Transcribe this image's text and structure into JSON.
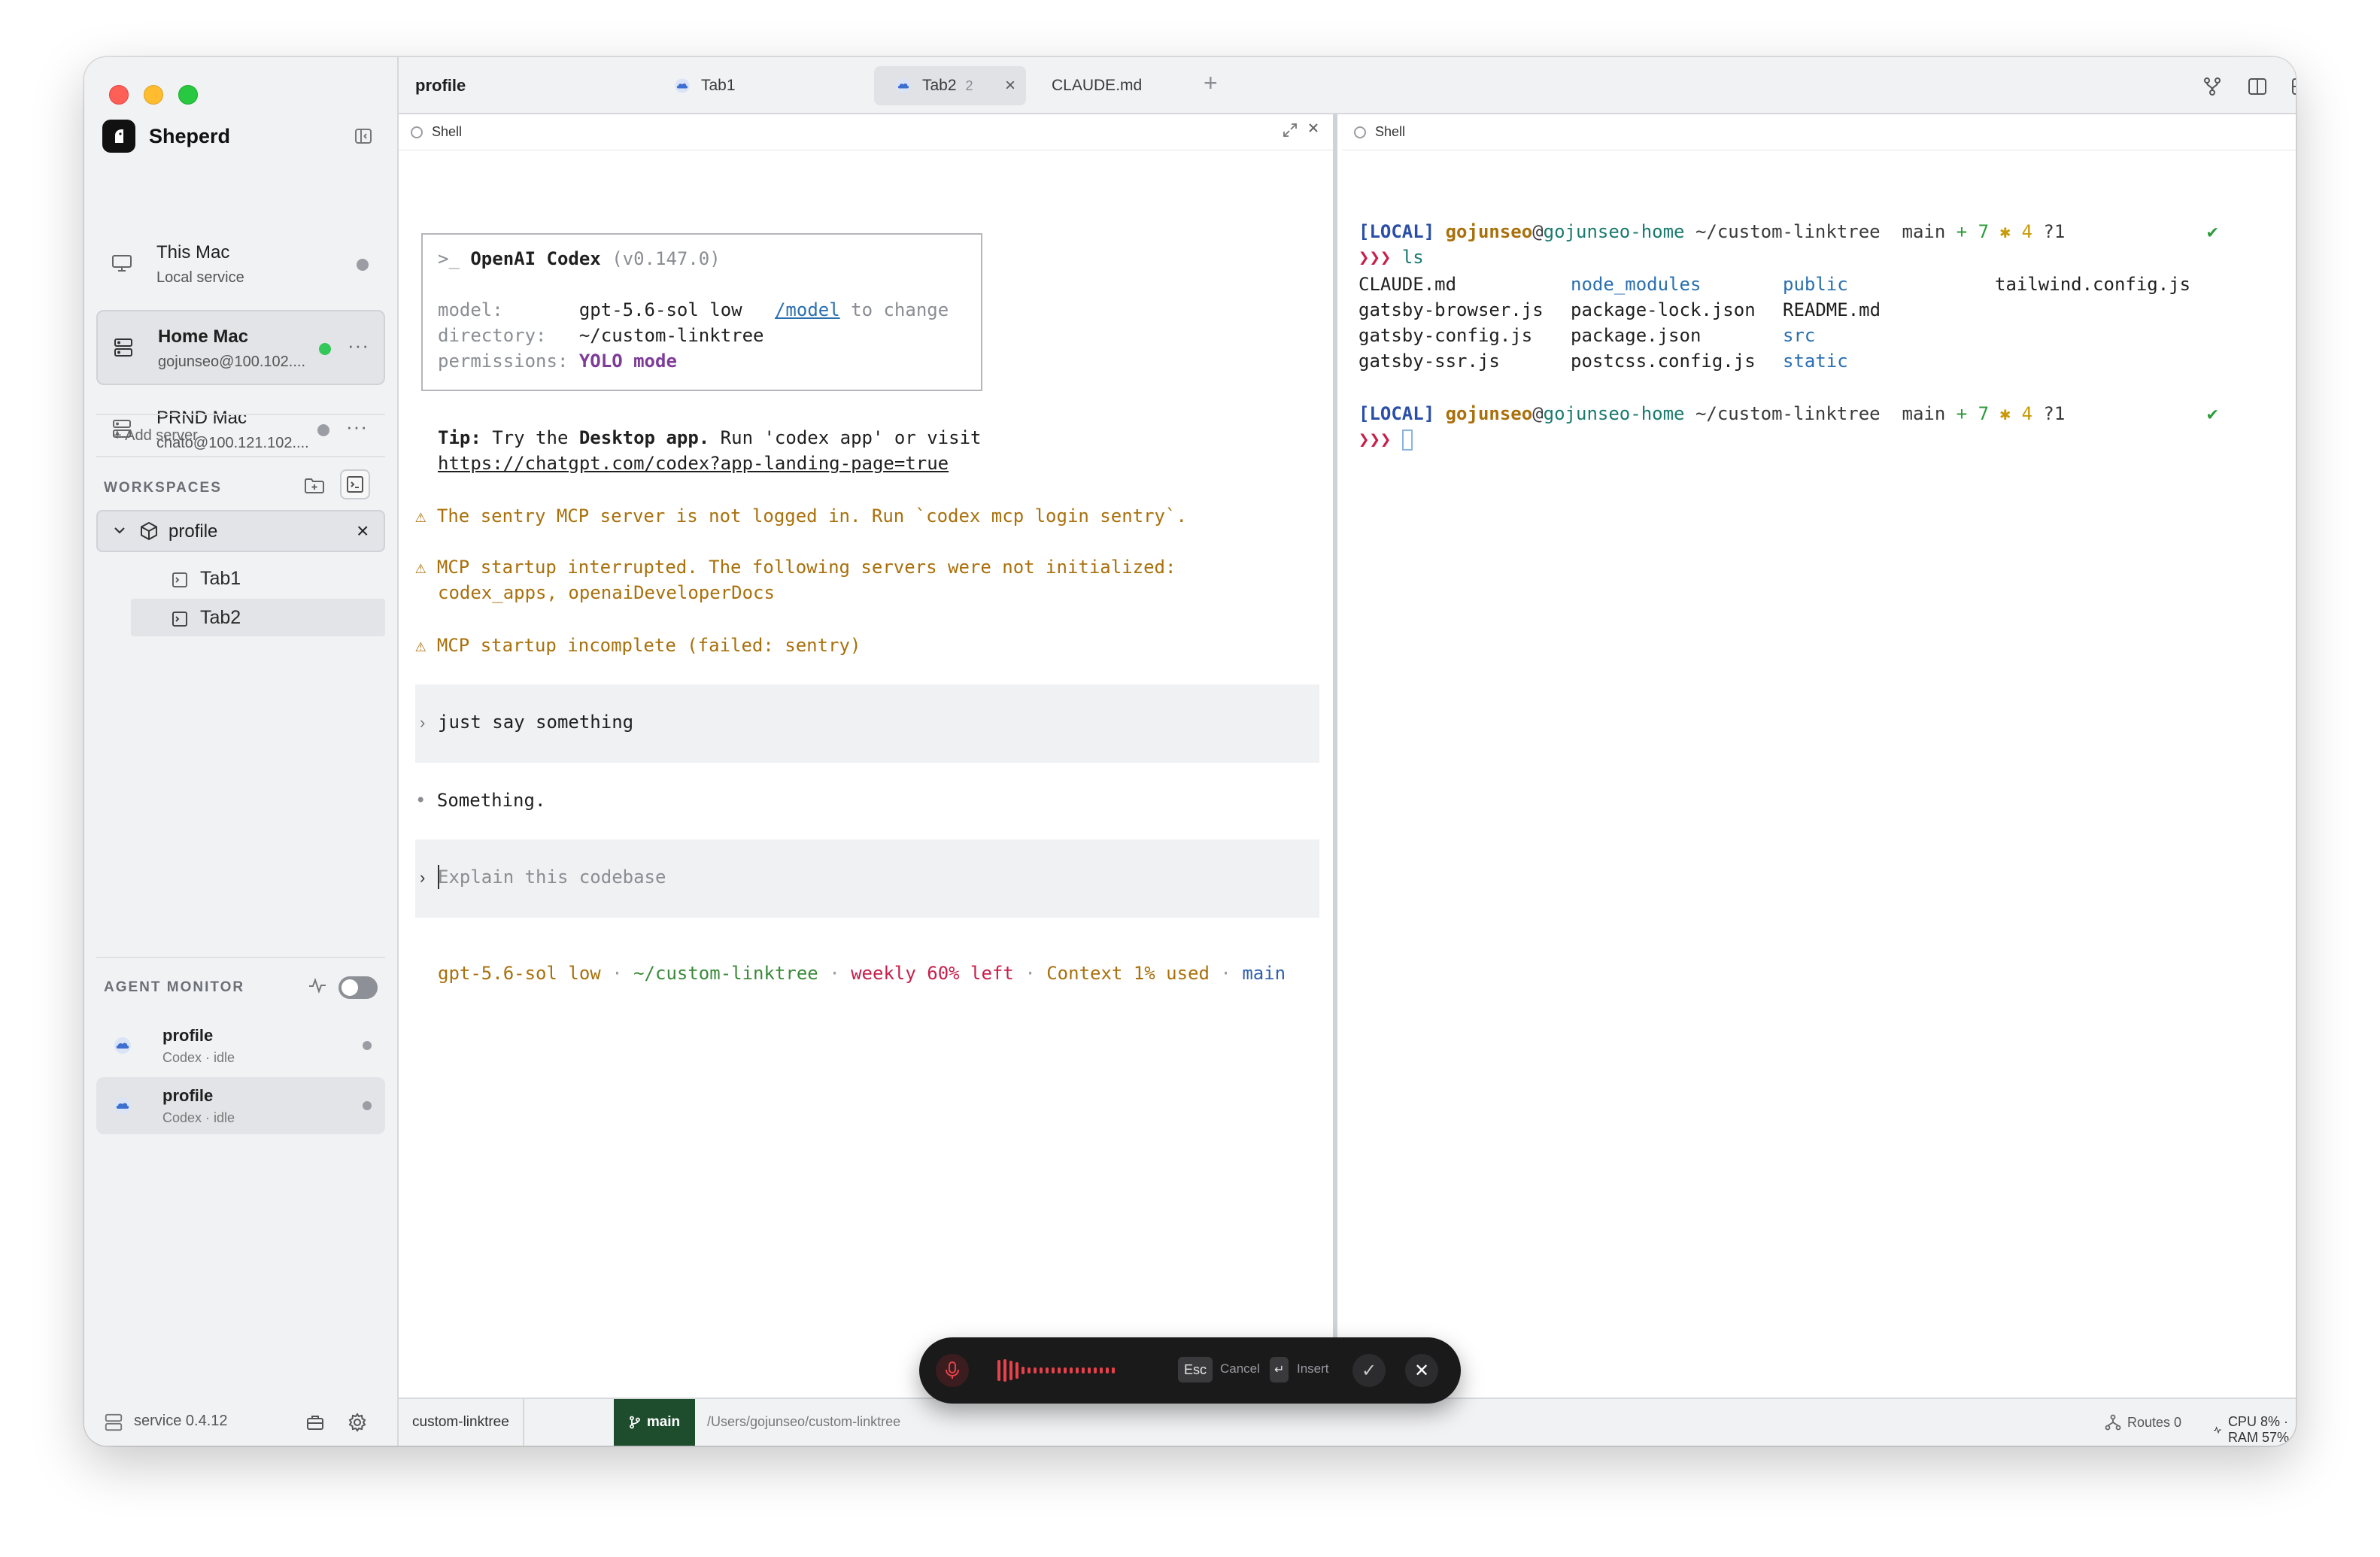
{
  "app": {
    "name": "Sheperd"
  },
  "servers": [
    {
      "name": "This Mac",
      "sub": "Local service",
      "status": "idle"
    },
    {
      "name": "Home Mac",
      "sub": "gojunseo@100.102....",
      "status": "online",
      "more": "···"
    },
    {
      "name": "PRND Mac",
      "sub": "chato@100.121.102....",
      "status": "offline",
      "more": "···"
    }
  ],
  "add_server_label": "+ Add server",
  "workspaces": {
    "label": "WORKSPACES",
    "active": {
      "name": "profile",
      "close": "×"
    },
    "tabs": [
      {
        "label": "Tab1"
      },
      {
        "label": "Tab2"
      }
    ]
  },
  "agent_monitor": {
    "label": "AGENT MONITOR",
    "enabled": false,
    "agents": [
      {
        "name": "profile",
        "status": "Codex · idle"
      },
      {
        "name": "profile",
        "status": "Codex · idle"
      }
    ]
  },
  "sidebar_footer": {
    "service": "service 0.4.12"
  },
  "topbar": {
    "workspace_title": "profile",
    "tabs": [
      {
        "label": "Tab1"
      },
      {
        "label": "Tab2",
        "count": "2",
        "close": "×"
      },
      {
        "label": "CLAUDE.md"
      }
    ],
    "add": "+"
  },
  "left_pane": {
    "title": "Shell",
    "codex_box": {
      "header_prompt": ">_",
      "header_name": "OpenAI Codex",
      "header_version": "(v0.147.0)",
      "model_key": "model:",
      "model_value": "gpt-5.6-sol low",
      "model_link": "/model",
      "model_hint": "to change",
      "dir_key": "directory:",
      "dir_value": "~/custom-linktree",
      "perm_key": "permissions:",
      "perm_value": "YOLO mode"
    },
    "tip": {
      "label": "Tip:",
      "text1": " Try the ",
      "bold": "Desktop app.",
      "text2": " Run 'codex app' or visit",
      "url": "https://chatgpt.com/codex?app-landing-page=true"
    },
    "warnings": [
      "⚠ The sentry MCP server is not logged in. Run `codex mcp login sentry`.",
      "⚠ MCP startup interrupted. The following servers were not initialized:",
      "codex_apps, openaiDeveloperDocs",
      "⚠ MCP startup incomplete (failed: sentry)"
    ],
    "user_message": "just say something",
    "reply_bullet": "•",
    "reply": "Something.",
    "input_placeholder": "Explain this codebase",
    "status": {
      "model": "gpt-5.6-sol low",
      "path": "~/custom-linktree",
      "weekly": "weekly 60% left",
      "context": "Context 1% used",
      "branch": "main",
      "sep": "·"
    }
  },
  "right_pane": {
    "title": "Shell",
    "prompt": {
      "local": "[LOCAL]",
      "user": "gojunseo",
      "at": "@",
      "host": "gojunseo-home",
      "path": "~/custom-linktree",
      "branch_icon": "",
      "branch": "main",
      "plus": "+ 7",
      "star": "✱ 4",
      "untracked": "?1",
      "check": "✔",
      "arrows": "❯❯❯"
    },
    "command": "ls",
    "listing": [
      [
        {
          "t": "CLAUDE.md",
          "k": "file"
        },
        {
          "t": "node_modules",
          "k": "dir"
        },
        {
          "t": "public",
          "k": "dir"
        },
        {
          "t": "tailwind.config.js",
          "k": "file"
        }
      ],
      [
        {
          "t": "gatsby-browser.js",
          "k": "file"
        },
        {
          "t": "package-lock.json",
          "k": "file"
        },
        {
          "t": "README.md",
          "k": "file"
        },
        {
          "t": "",
          "k": "file"
        }
      ],
      [
        {
          "t": "gatsby-config.js",
          "k": "file"
        },
        {
          "t": "package.json",
          "k": "file"
        },
        {
          "t": "src",
          "k": "dir"
        },
        {
          "t": "",
          "k": "file"
        }
      ],
      [
        {
          "t": "gatsby-ssr.js",
          "k": "file"
        },
        {
          "t": "postcss.config.js",
          "k": "file"
        },
        {
          "t": "static",
          "k": "dir"
        },
        {
          "t": "",
          "k": "file"
        }
      ]
    ]
  },
  "footer": {
    "workspace": "custom-linktree",
    "branch": "main",
    "path": "/Users/gojunseo/custom-linktree",
    "routes": "Routes 0",
    "cpu": "CPU 8% · RAM 57%"
  },
  "voice": {
    "esc_key": "Esc",
    "esc_label": "Cancel",
    "insert_key": "↵",
    "insert_label": "Insert",
    "confirm": "✓",
    "close": "✕"
  },
  "colors": {
    "accent_green": "#34c759",
    "branch_bg": "#1d4d2c",
    "warning": "#a9700b",
    "recording": "#e8414a"
  }
}
